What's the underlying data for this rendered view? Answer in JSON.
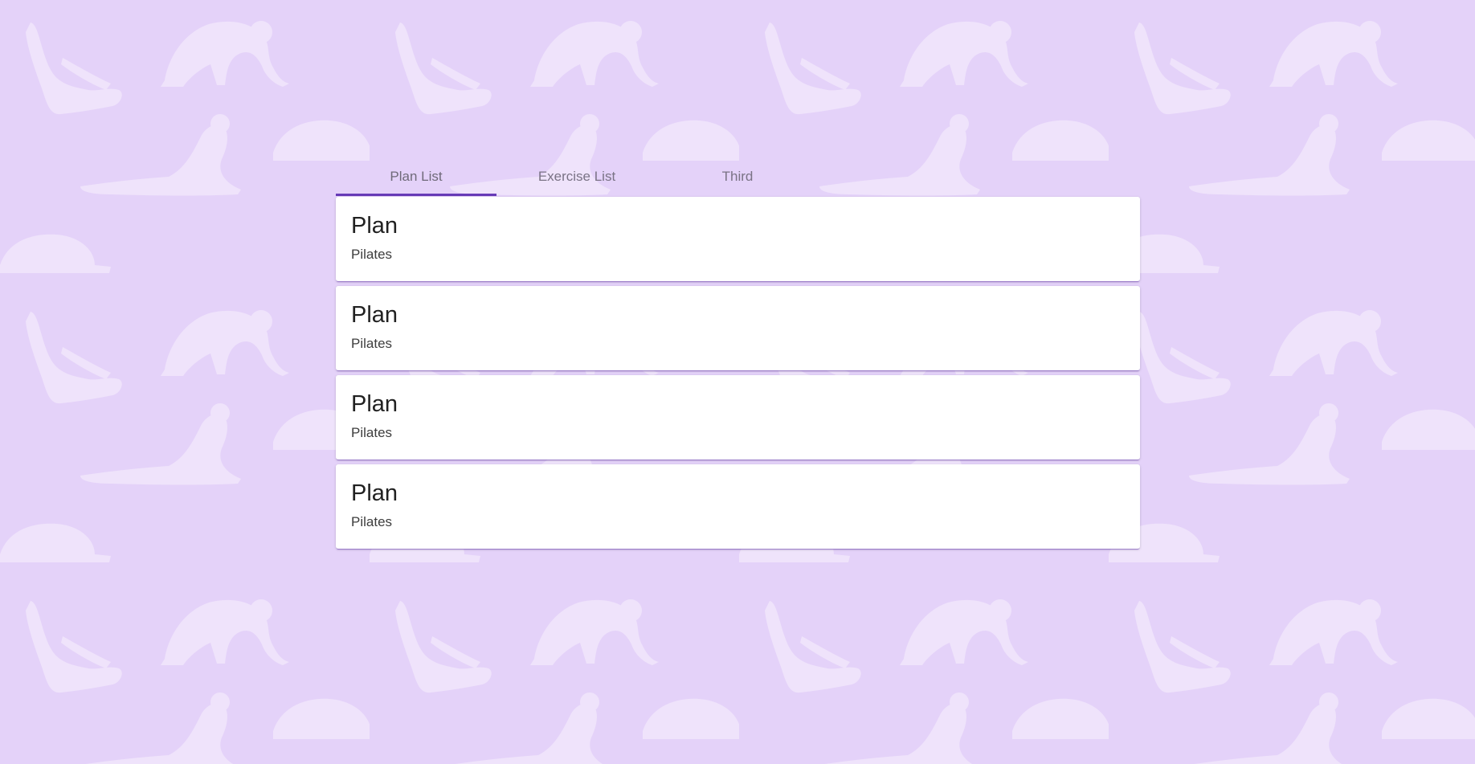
{
  "tabs": [
    {
      "label": "Plan List",
      "active": true
    },
    {
      "label": "Exercise List",
      "active": false
    },
    {
      "label": "Third",
      "active": false
    }
  ],
  "plans": [
    {
      "title": "Plan",
      "subtitle": "Pilates"
    },
    {
      "title": "Plan",
      "subtitle": "Pilates"
    },
    {
      "title": "Plan",
      "subtitle": "Pilates"
    },
    {
      "title": "Plan",
      "subtitle": "Pilates"
    }
  ],
  "colors": {
    "background": "#e4d2f9",
    "pattern": "#efe3fb",
    "accent": "#673ab7",
    "card": "#ffffff"
  },
  "background_pattern": "yoga-silhouettes-pattern"
}
